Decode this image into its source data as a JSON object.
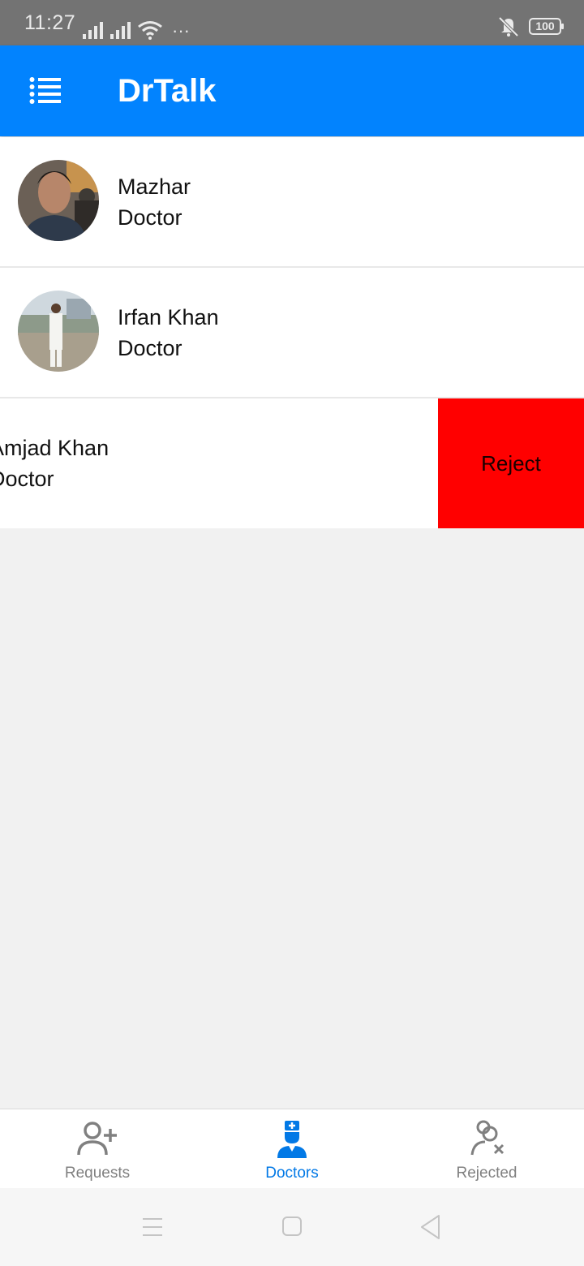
{
  "status_bar": {
    "time": "11:27",
    "more": "···",
    "battery": "100"
  },
  "app_bar": {
    "title": "DrTalk",
    "menu_icon": "menu-list-icon"
  },
  "doctors": [
    {
      "name": "Mazhar",
      "role": "Doctor"
    },
    {
      "name": "Irfan Khan",
      "role": "Doctor"
    },
    {
      "name": "Amjad Khan",
      "name_visible": "njad Khan",
      "role": "Doctor",
      "role_visible": "ctor",
      "action_label": "Reject"
    }
  ],
  "bottom_nav": {
    "items": [
      {
        "label": "Requests",
        "icon": "add-user-icon"
      },
      {
        "label": "Doctors",
        "icon": "doctor-icon",
        "active": true
      },
      {
        "label": "Rejected",
        "icon": "rejected-user-icon"
      }
    ]
  },
  "colors": {
    "primary": "#0283fe",
    "reject": "#ff0000",
    "active_tab": "#0279e6",
    "inactive_tab": "#808080"
  }
}
